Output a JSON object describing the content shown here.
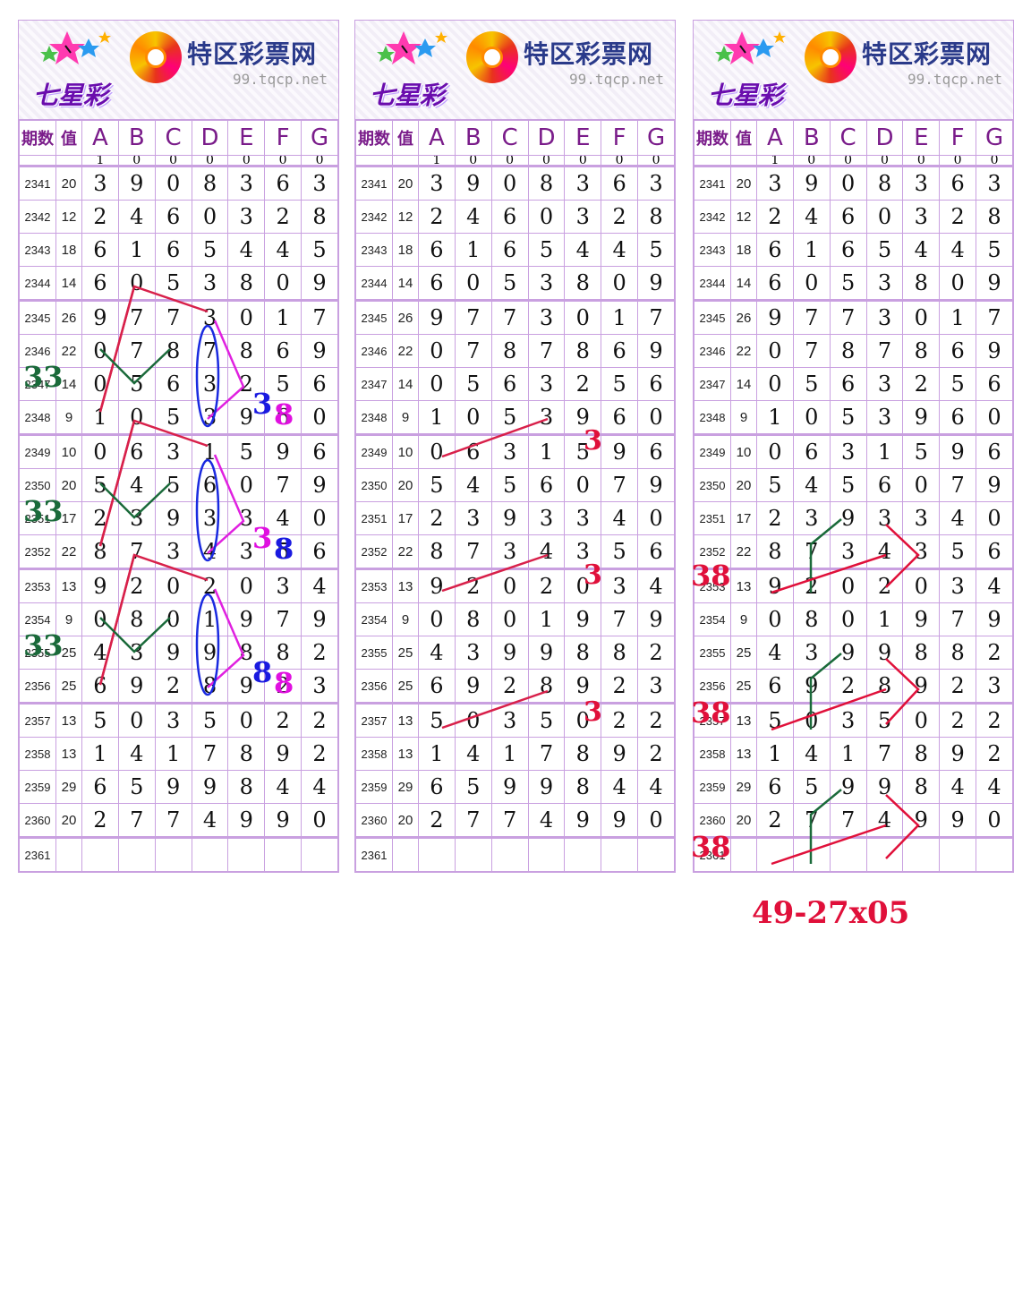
{
  "header": {
    "lottery_name": "七星彩",
    "site_name": "特区彩票网",
    "site_url": "99.tqcp.net"
  },
  "columns": {
    "period": "期数",
    "value": "值",
    "digits": [
      "A",
      "B",
      "C",
      "D",
      "E",
      "F",
      "G"
    ]
  },
  "partial_row": [
    "1",
    "0",
    "0",
    "0",
    "0",
    "0",
    "0"
  ],
  "rows": [
    {
      "period": "2341",
      "value": "20",
      "digits": [
        "3",
        "9",
        "0",
        "8",
        "3",
        "6",
        "3"
      ]
    },
    {
      "period": "2342",
      "value": "12",
      "digits": [
        "2",
        "4",
        "6",
        "0",
        "3",
        "2",
        "8"
      ]
    },
    {
      "period": "2343",
      "value": "18",
      "digits": [
        "6",
        "1",
        "6",
        "5",
        "4",
        "4",
        "5"
      ]
    },
    {
      "period": "2344",
      "value": "14",
      "digits": [
        "6",
        "0",
        "5",
        "3",
        "8",
        "0",
        "9"
      ]
    },
    {
      "period": "2345",
      "value": "26",
      "digits": [
        "9",
        "7",
        "7",
        "3",
        "0",
        "1",
        "7"
      ]
    },
    {
      "period": "2346",
      "value": "22",
      "digits": [
        "0",
        "7",
        "8",
        "7",
        "8",
        "6",
        "9"
      ]
    },
    {
      "period": "2347",
      "value": "14",
      "digits": [
        "0",
        "5",
        "6",
        "3",
        "2",
        "5",
        "6"
      ]
    },
    {
      "period": "2348",
      "value": "9",
      "digits": [
        "1",
        "0",
        "5",
        "3",
        "9",
        "6",
        "0"
      ]
    },
    {
      "period": "2349",
      "value": "10",
      "digits": [
        "0",
        "6",
        "3",
        "1",
        "5",
        "9",
        "6"
      ]
    },
    {
      "period": "2350",
      "value": "20",
      "digits": [
        "5",
        "4",
        "5",
        "6",
        "0",
        "7",
        "9"
      ]
    },
    {
      "period": "2351",
      "value": "17",
      "digits": [
        "2",
        "3",
        "9",
        "3",
        "3",
        "4",
        "0"
      ]
    },
    {
      "period": "2352",
      "value": "22",
      "digits": [
        "8",
        "7",
        "3",
        "4",
        "3",
        "5",
        "6"
      ]
    },
    {
      "period": "2353",
      "value": "13",
      "digits": [
        "9",
        "2",
        "0",
        "2",
        "0",
        "3",
        "4"
      ]
    },
    {
      "period": "2354",
      "value": "9",
      "digits": [
        "0",
        "8",
        "0",
        "1",
        "9",
        "7",
        "9"
      ]
    },
    {
      "period": "2355",
      "value": "25",
      "digits": [
        "4",
        "3",
        "9",
        "9",
        "8",
        "8",
        "2"
      ]
    },
    {
      "period": "2356",
      "value": "25",
      "digits": [
        "6",
        "9",
        "2",
        "8",
        "9",
        "2",
        "3"
      ]
    },
    {
      "period": "2357",
      "value": "13",
      "digits": [
        "5",
        "0",
        "3",
        "5",
        "0",
        "2",
        "2"
      ]
    },
    {
      "period": "2358",
      "value": "13",
      "digits": [
        "1",
        "4",
        "1",
        "7",
        "8",
        "9",
        "2"
      ]
    },
    {
      "period": "2359",
      "value": "29",
      "digits": [
        "6",
        "5",
        "9",
        "9",
        "8",
        "4",
        "4"
      ]
    },
    {
      "period": "2360",
      "value": "20",
      "digits": [
        "2",
        "7",
        "7",
        "4",
        "9",
        "9",
        "0"
      ]
    },
    {
      "period": "2361",
      "value": "",
      "digits": [
        "",
        "",
        "",
        "",
        "",
        "",
        ""
      ]
    }
  ],
  "annotations": {
    "panel1_left_marks": [
      "33",
      "33",
      "33"
    ],
    "panel1_right_marks": [
      {
        "a": "3",
        "b": "8",
        "color_a": "#1a1ae0",
        "color_b": "#e010e0"
      },
      {
        "a": "3",
        "b": "8",
        "color_a": "#e010e0",
        "color_b": "#1a1ae0"
      },
      {
        "a": "8",
        "b": "8",
        "color_a": "#1a1ae0",
        "color_b": "#e010e0"
      }
    ],
    "panel2_marks": [
      "3",
      "3",
      "3"
    ],
    "panel3_marks": [
      "38",
      "38",
      "38"
    ],
    "formula": "49-27x05"
  },
  "colors": {
    "grid": "#c9a0e0",
    "header_text": "#7a1c8a",
    "mark_green": "#1a6a3a",
    "mark_red": "#e0103a",
    "line_crimson": "#d8204a",
    "line_magenta": "#e020e0",
    "oval_blue": "#1a2ae0"
  }
}
